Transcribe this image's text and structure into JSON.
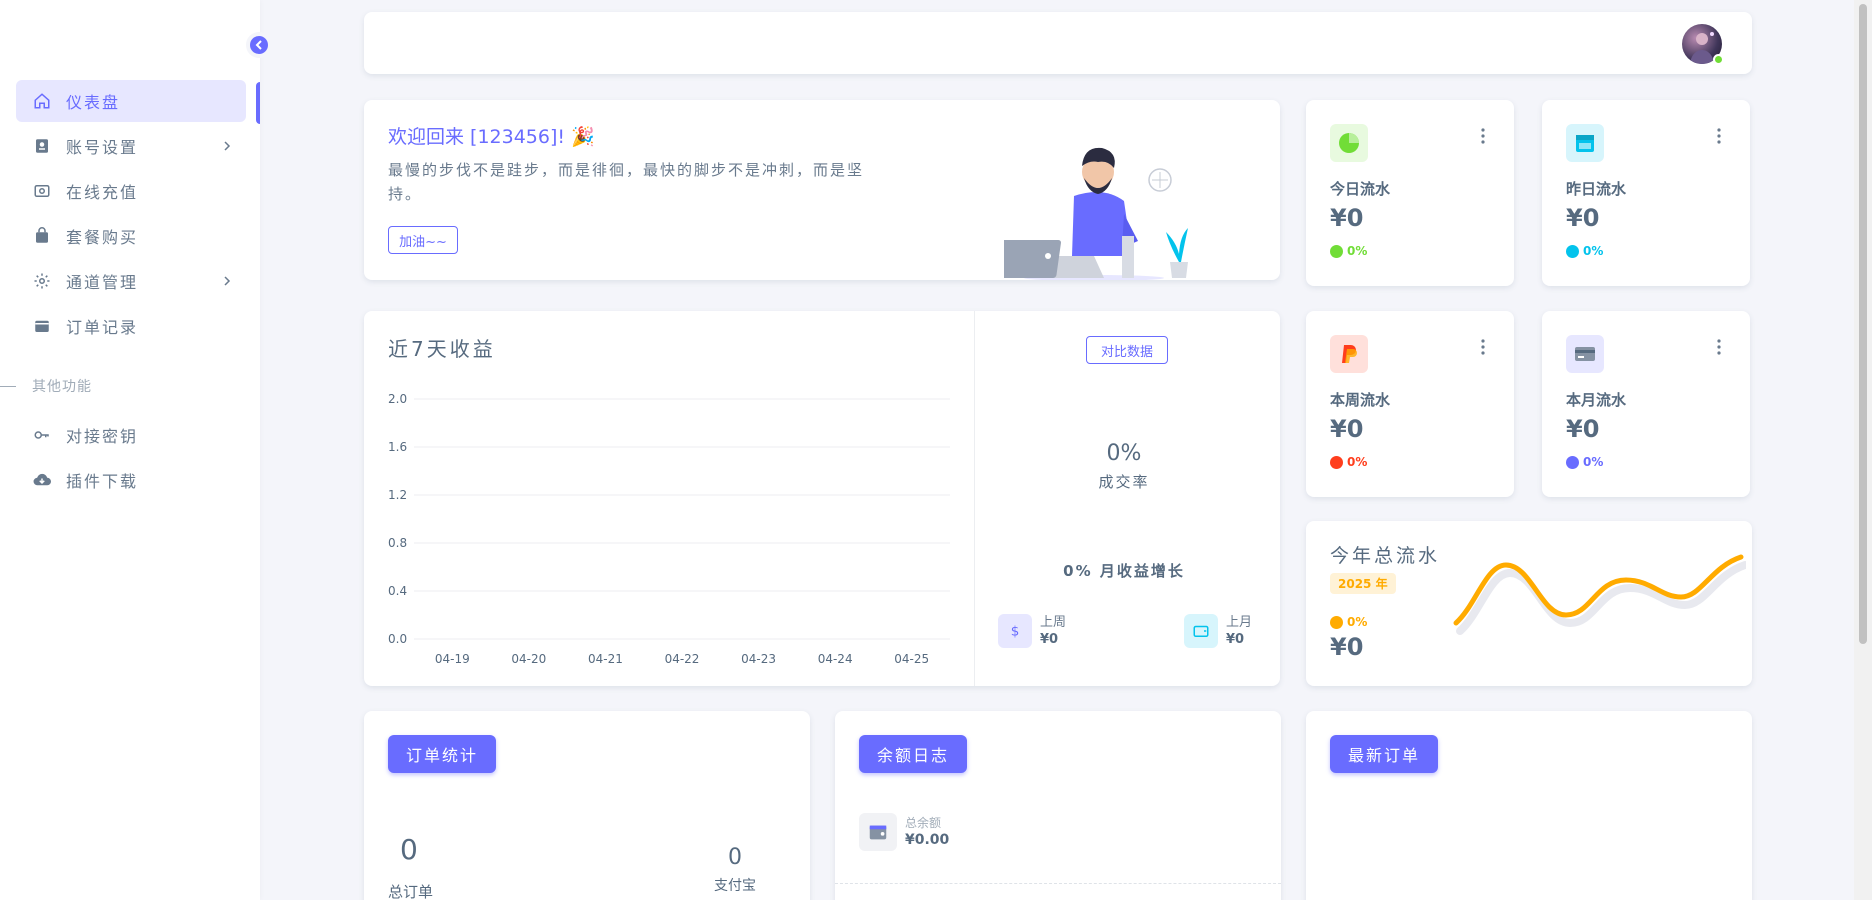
{
  "sidebar": {
    "items": [
      {
        "label": "仪表盘",
        "icon": "home-icon"
      },
      {
        "label": "账号设置",
        "icon": "account-icon"
      },
      {
        "label": "在线充值",
        "icon": "wallet-icon"
      },
      {
        "label": "套餐购买",
        "icon": "shopping-icon"
      },
      {
        "label": "通道管理",
        "icon": "gear-icon"
      },
      {
        "label": "订单记录",
        "icon": "order-icon"
      }
    ],
    "section_header": "其他功能",
    "extra_items": [
      {
        "label": "对接密钥",
        "icon": "key-icon"
      },
      {
        "label": "插件下载",
        "icon": "cloud-download-icon"
      }
    ]
  },
  "welcome": {
    "title": "欢迎回来 [123456]! 🎉",
    "text": "最慢的步伐不是跬步，而是徘徊，最快的脚步不是冲刺，而是坚持。",
    "button": "加油~~"
  },
  "stats": [
    {
      "label": "今日流水",
      "value": "¥0",
      "pct": "0%",
      "color": "#71dd37",
      "icon": "pie-chart-icon"
    },
    {
      "label": "昨日流水",
      "value": "¥0",
      "pct": "0%",
      "color": "#03c3ec",
      "icon": "calendar-icon"
    },
    {
      "label": "本周流水",
      "value": "¥0",
      "pct": "0%",
      "color": "#ff3e1d",
      "icon": "paypal-icon"
    },
    {
      "label": "本月流水",
      "value": "¥0",
      "pct": "0%",
      "color": "#696cff",
      "icon": "credit-card-icon"
    }
  ],
  "income": {
    "title": "近7天收益",
    "compare_button": "对比数据",
    "rate_value": "0%",
    "rate_label": "成交率",
    "growth": "0% 月收益增长",
    "last_week_label": "上周",
    "last_week_value": "¥0",
    "last_month_label": "上月",
    "last_month_value": "¥0"
  },
  "chart_data": {
    "type": "bar",
    "categories": [
      "04-19",
      "04-20",
      "04-21",
      "04-22",
      "04-23",
      "04-24",
      "04-25"
    ],
    "values": [
      0,
      0,
      0,
      0,
      0,
      0,
      0
    ],
    "title": "近7天收益",
    "xlabel": "",
    "ylabel": "",
    "ylim": [
      0,
      2.0
    ],
    "yticks": [
      "2.0",
      "1.6",
      "1.2",
      "0.8",
      "0.4",
      "0.0"
    ],
    "grid": true
  },
  "year": {
    "title": "今年总流水",
    "badge": "2025 年",
    "pct": "0%",
    "value": "¥0",
    "color": "#ffab00"
  },
  "orders": {
    "button": "订单统计",
    "total_value": "0",
    "total_label": "总订单",
    "alipay_value": "0",
    "alipay_label": "支付宝"
  },
  "balance": {
    "button": "余额日志",
    "label": "总余额",
    "value": "¥0.00"
  },
  "latest": {
    "button": "最新订单"
  },
  "colors": {
    "primary": "#696cff",
    "success": "#71dd37",
    "info": "#03c3ec",
    "danger": "#ff3e1d",
    "warning": "#ffab00"
  }
}
